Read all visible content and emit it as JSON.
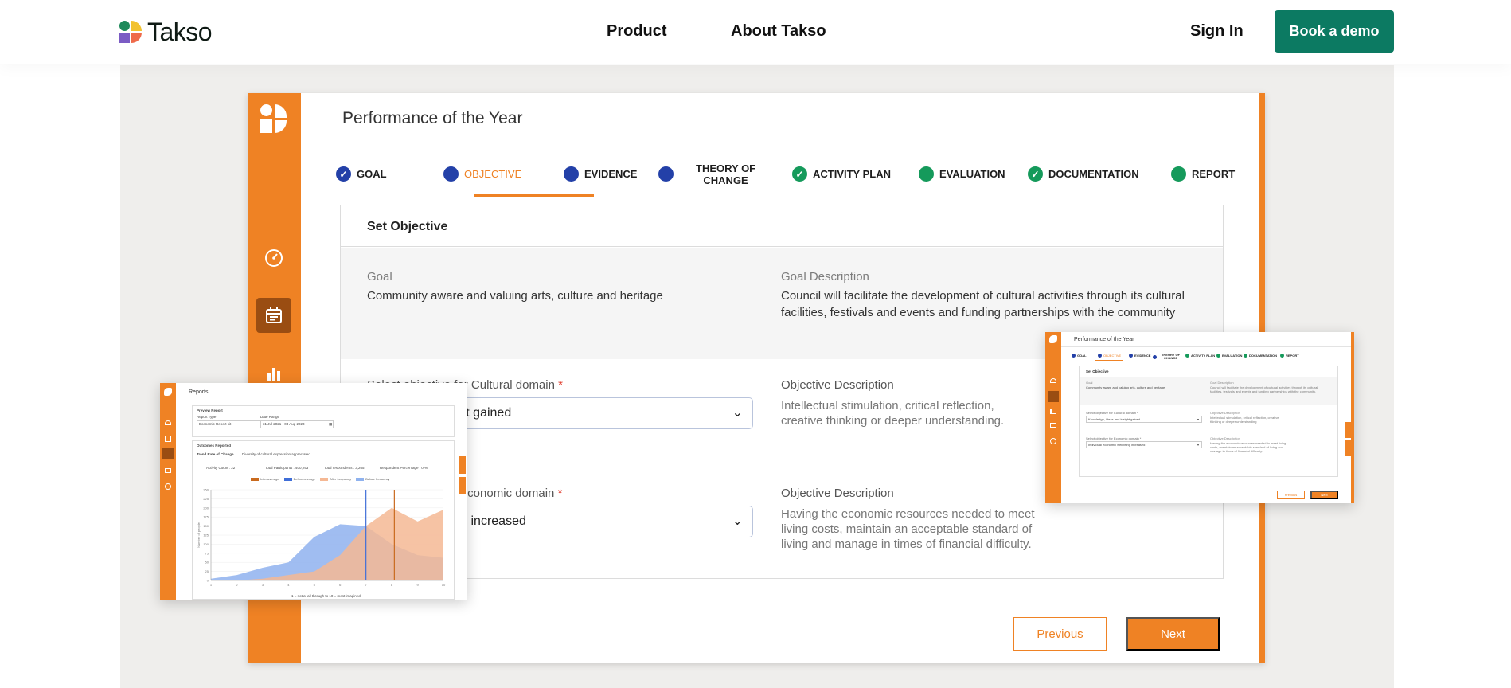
{
  "nav": {
    "brand": "Takso",
    "links": [
      "Product",
      "About Takso"
    ],
    "signin": "Sign In",
    "cta": "Book a demo"
  },
  "colors": {
    "brand_green": "#0c7a62",
    "app_orange": "#ef8224",
    "step_blue": "#2340a8",
    "step_green": "#159a5b"
  },
  "app": {
    "title": "Performance of the Year",
    "sidebar_icons": [
      "dashboard-gauge-icon",
      "calendar-list-icon",
      "bar-chart-icon"
    ],
    "steps": [
      {
        "label": "GOAL",
        "state": "done-blue"
      },
      {
        "label": "OBJECTIVE",
        "state": "active"
      },
      {
        "label": "EVIDENCE",
        "state": "blue"
      },
      {
        "label": "THEORY OF CHANGE",
        "line1": "THEORY OF",
        "line2": "CHANGE",
        "state": "blue"
      },
      {
        "label": "ACTIVITY PLAN",
        "state": "done-green"
      },
      {
        "label": "EVALUATION",
        "state": "green"
      },
      {
        "label": "DOCUMENTATION",
        "state": "done-green"
      },
      {
        "label": "REPORT",
        "state": "green"
      }
    ],
    "card_title": "Set Objective",
    "goal_label": "Goal",
    "goal_value": "Community aware and valuing arts, culture and heritage",
    "goal_desc_label": "Goal Description",
    "goal_desc_value": "Council will facilitate the development of cultural activities through its cultural facilities, festivals and events and funding partnerships with the community",
    "cultural": {
      "label": "Select objective for Cultural domain",
      "required": "*",
      "selected": "as and insight gained",
      "desc_label": "Objective Description",
      "desc_value": "Intellectual stimulation, critical reflection, creative thinking or deeper understanding."
    },
    "economic": {
      "label": "r Economic domain",
      "required": "*",
      "selected": "mic wellbeing increased",
      "desc_label": "Objective Description",
      "desc_value": "Having the economic resources needed to meet living costs, maintain an acceptable standard of living and manage in times of financial difficulty."
    },
    "prev": "Previous",
    "next": "Next"
  },
  "reports_card": {
    "title": "Reports",
    "preview": "Preview Report",
    "report_type_label": "Report Type",
    "report_type_value": "Economic Report kit",
    "date_range_label": "Date Range",
    "date_range_value": "31 Jul 2021 - 03 Aug 2023",
    "outcomes": "Outcomes Reported",
    "trend": "Trend Rate of Change",
    "trend_value": "Diversity of cultural expression appreciated",
    "stats": [
      "Activity Count : 22",
      "Total Participants : 400,293",
      "Total respondents : 3,265",
      "Respondent Percentage : 0 %"
    ],
    "legend": [
      "Inter average",
      "Before average",
      "After frequency",
      "Before frequency"
    ],
    "xaxis_note": "1 = not at all through to 10 = most imagined",
    "yaxis_label": "Number of people"
  },
  "chart_data": {
    "type": "area",
    "x": [
      1,
      2,
      3,
      4,
      5,
      6,
      7,
      8,
      9,
      10
    ],
    "series": [
      {
        "name": "Before frequency",
        "color": "#8fb2ee",
        "values": [
          2,
          6,
          14,
          20,
          48,
          62,
          60,
          40,
          28,
          25
        ]
      },
      {
        "name": "After frequency",
        "color": "#f5b894",
        "values": [
          0,
          0,
          2,
          6,
          10,
          28,
          60,
          80,
          65,
          78
        ]
      }
    ],
    "markers": [
      {
        "name": "Before average",
        "x": 7.0,
        "color": "#3f6ed8"
      },
      {
        "name": "Inter average",
        "x": 8.1,
        "color": "#c96a1e"
      }
    ],
    "ylim": [
      0,
      100
    ],
    "xlim": [
      1,
      10
    ]
  },
  "mini_card": {
    "title": "Performance of the Year",
    "steps": [
      "GOAL",
      "OBJECTIVE",
      "EVIDENCE",
      "THEORY OF CHANGE",
      "ACTIVITY PLAN",
      "EVALUATION",
      "DOCUMENTATION",
      "REPORT"
    ],
    "card_title": "Set Objective",
    "goal_label": "Goal",
    "goal_value": "Community aware and valuing arts, culture and heritage",
    "goal_desc_label": "Goal Description",
    "goal_desc_value": "Council will facilitate the development of cultural activities through its cultural facilities, festivals and events and funding partnerships with the community.",
    "cultural_label": "Select objective for Cultural domain *",
    "cultural_value": "Knowledge, ideas and insight gained",
    "cultural_desc_label": "Objective Description",
    "cultural_desc": "Intellectual stimulation, critical reflection, creative thinking or deeper understanding",
    "economic_label": "Select objective for Economic domain *",
    "economic_value": "Individual economic wellbeing increased",
    "economic_desc_label": "Objective Description",
    "economic_desc": "Having the economic resources needed to meet living costs, maintain an acceptable standard of living and manage in times of financial difficulty.",
    "prev": "Previous",
    "next": "Next"
  }
}
